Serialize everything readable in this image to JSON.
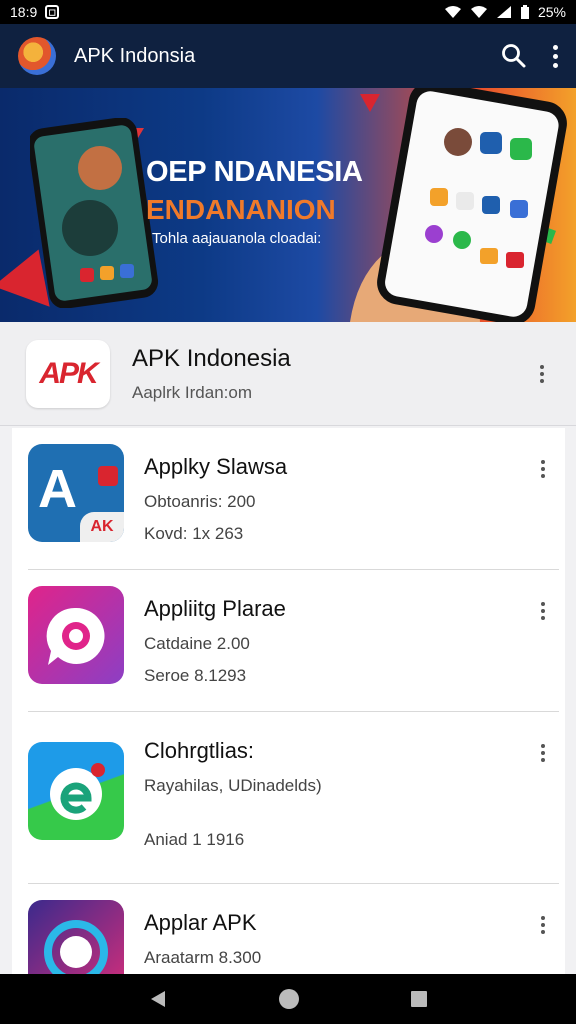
{
  "status_bar": {
    "time": "18:9",
    "battery": "25%"
  },
  "app_bar": {
    "title": "APK Indonsia",
    "actions": [
      "search-icon",
      "more-vert-icon"
    ]
  },
  "banner": {
    "headline": "OEP NDANESIA",
    "subhead": "ENDANANION",
    "tagline": "Tohla aajauanola cloadai:"
  },
  "featured": {
    "name": "APK Indonesia",
    "subtitle": "Aaplrk Irdan:om",
    "icon_text": "APK"
  },
  "apps": [
    {
      "title": "Applky Slawsa",
      "line1": "Obtoanris: 200",
      "line2": "Kovd: 1x 263",
      "icon_text": "A",
      "badge": "AK"
    },
    {
      "title": "Appliitg Plarae",
      "line1": "Catdaine 2.00",
      "line2": "Seroe 8.1293"
    },
    {
      "title": "Clohrgtlias:",
      "line1": "Rayahilas, UDinadelds)",
      "line2": "Aniad 1 1916"
    },
    {
      "title": "Applar APK",
      "line1": "Araatarm 8.300",
      "line2": ""
    }
  ],
  "colors": {
    "app_bar": "#0f2140",
    "accent_orange": "#f07a2a",
    "brand_red": "#d9252f",
    "brand_blue": "#1f5fae"
  }
}
